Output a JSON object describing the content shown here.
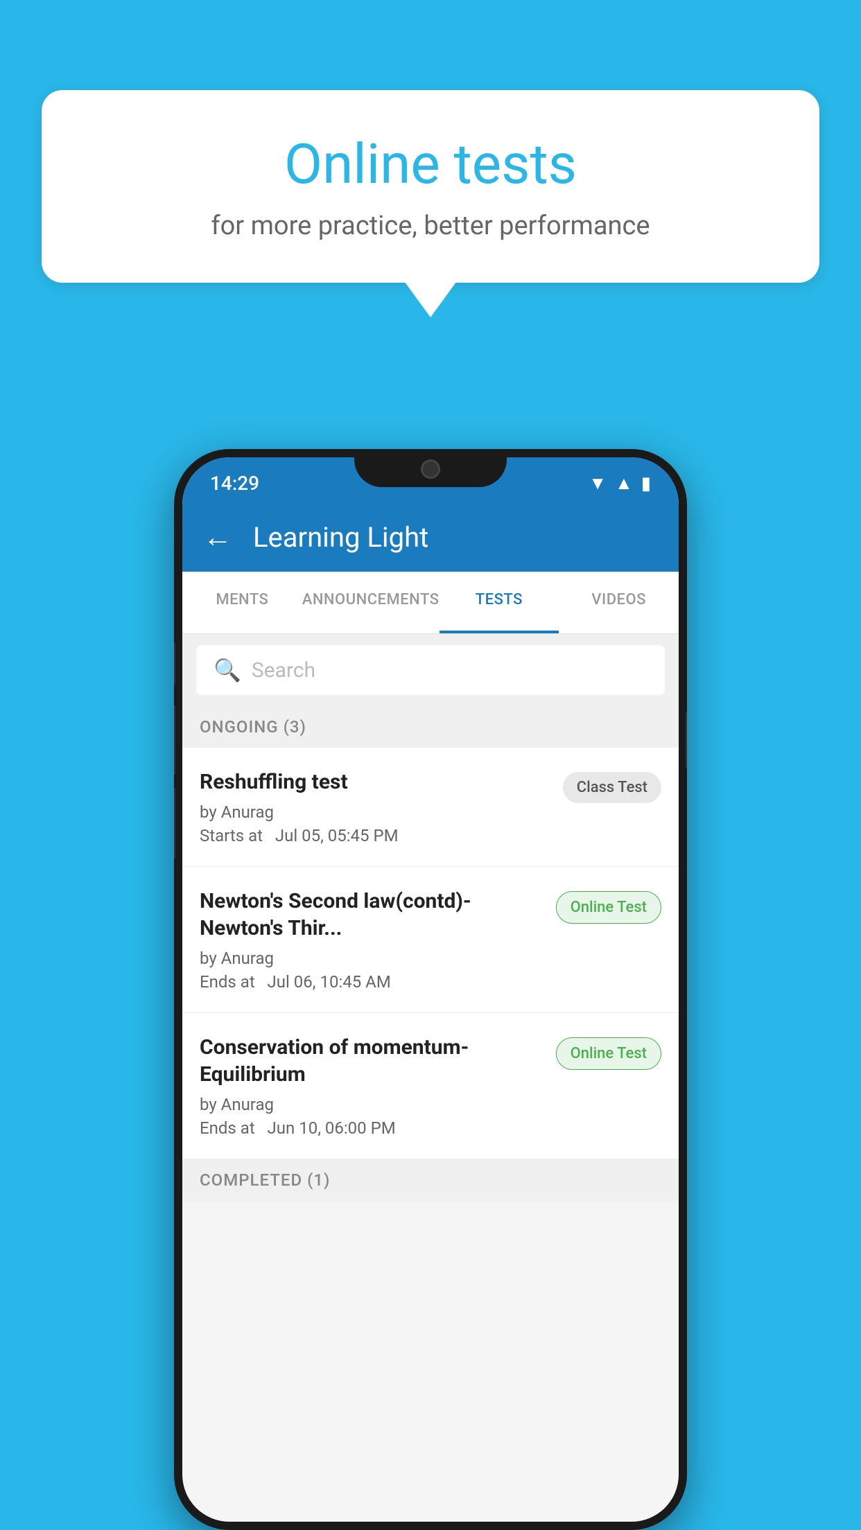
{
  "background_color": "#29b6e8",
  "speech_bubble": {
    "title": "Online tests",
    "subtitle": "for more practice, better performance"
  },
  "phone": {
    "status_bar": {
      "time": "14:29",
      "icons": [
        "wifi",
        "signal",
        "battery"
      ]
    },
    "app_bar": {
      "back_label": "←",
      "title": "Learning Light"
    },
    "tabs": [
      {
        "label": "MENTS",
        "active": false
      },
      {
        "label": "ANNOUNCEMENTS",
        "active": false
      },
      {
        "label": "TESTS",
        "active": true
      },
      {
        "label": "VIDEOS",
        "active": false
      }
    ],
    "search": {
      "placeholder": "Search",
      "icon": "🔍"
    },
    "sections": [
      {
        "header": "ONGOING (3)",
        "tests": [
          {
            "name": "Reshuffling test",
            "author": "by Anurag",
            "time_label": "Starts at",
            "time": "Jul 05, 05:45 PM",
            "badge": "Class Test",
            "badge_type": "class"
          },
          {
            "name": "Newton's Second law(contd)-Newton's Thir...",
            "author": "by Anurag",
            "time_label": "Ends at",
            "time": "Jul 06, 10:45 AM",
            "badge": "Online Test",
            "badge_type": "online"
          },
          {
            "name": "Conservation of momentum-Equilibrium",
            "author": "by Anurag",
            "time_label": "Ends at",
            "time": "Jun 10, 06:00 PM",
            "badge": "Online Test",
            "badge_type": "online"
          }
        ]
      },
      {
        "header": "COMPLETED (1)",
        "tests": []
      }
    ]
  }
}
